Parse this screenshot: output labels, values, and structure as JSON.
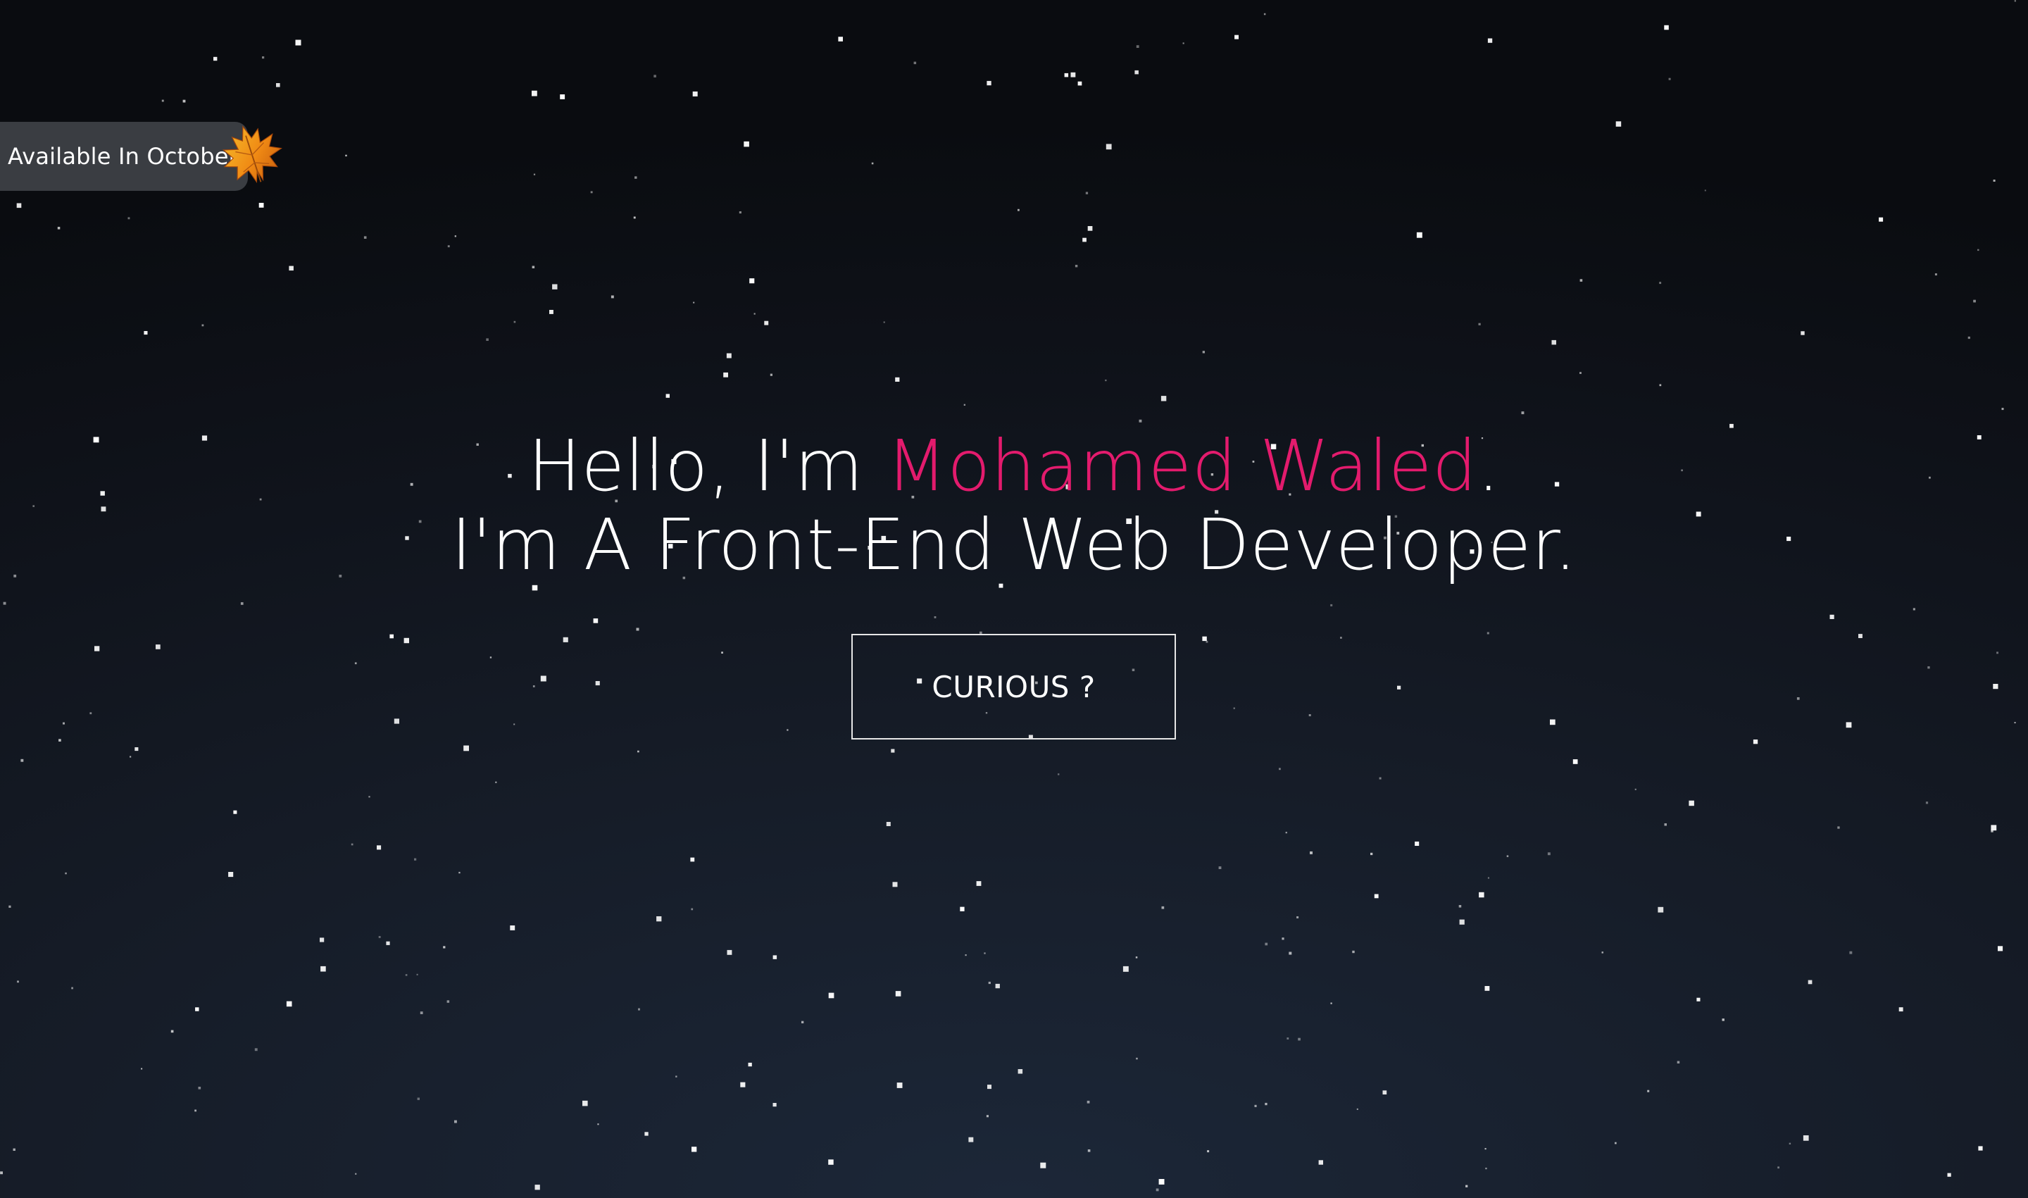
{
  "colors": {
    "accent": "#e31b6d",
    "text": "#ffffff",
    "badge_bg": "#3a3d42",
    "button_border": "#e6e6e6",
    "leaf": "#f2a51a"
  },
  "badge": {
    "label": "Available In October",
    "icon": "maple-leaf-icon"
  },
  "hero": {
    "greeting": "Hello, I'm ",
    "name": "Mohamed Waled",
    "greeting_end": ".",
    "tagline": "I'm A Front-End Web Developer."
  },
  "cta": {
    "label": "CURIOUS ?"
  }
}
